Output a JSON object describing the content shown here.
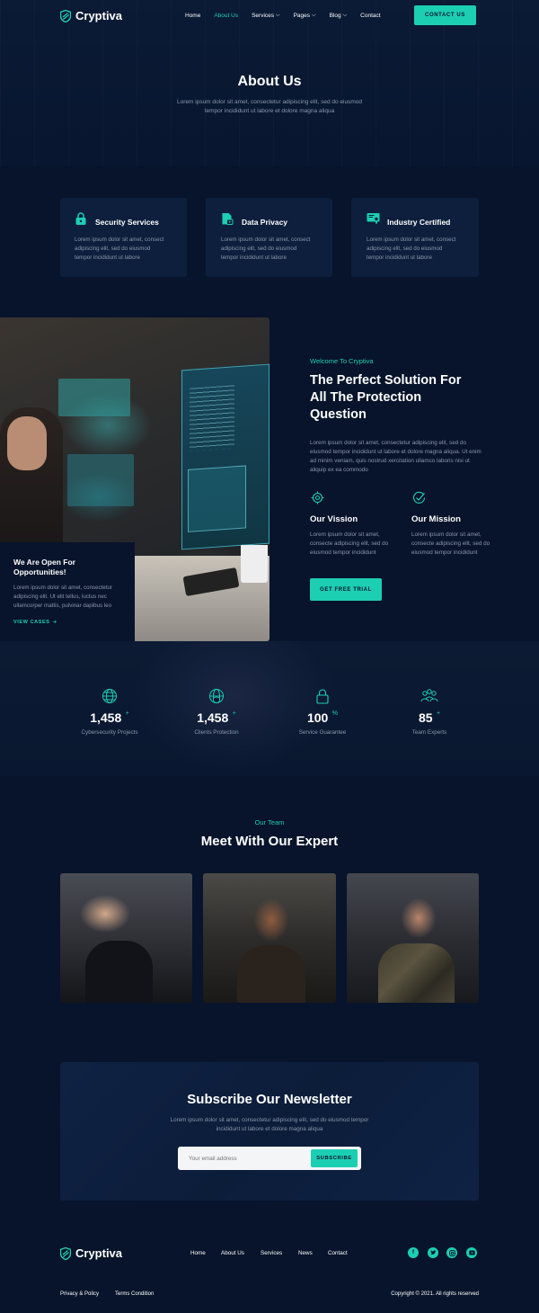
{
  "brand": {
    "name": "Cryptiva",
    "accent": "#1ccfb2",
    "background": "#07142b"
  },
  "nav": {
    "items": [
      "Home",
      "About Us",
      "Services",
      "Pages",
      "Blog",
      "Contact"
    ],
    "active": "About Us",
    "cta": "CONTACT US"
  },
  "hero": {
    "title": "About Us",
    "text1": "Lorem ipsum dolor sit amet, consectetur adipiscing elit, sed do eiusmod",
    "text2": "tempor incididunt ut labore et dolore magna aliqua"
  },
  "features": [
    {
      "icon": "lock-icon",
      "title": "Security Services",
      "l1": "Lorem ipsum dolor sit amet, consect",
      "l2": "adipiscing elit, sed do eiusmod",
      "l3": "tempor incididunt ut labore"
    },
    {
      "icon": "document-lock-icon",
      "title": "Data Privacy",
      "l1": "Lorem ipsum dolor sit amet, consect",
      "l2": "adipiscing elit, sed do eiusmod",
      "l3": "tempor incididunt ut labore"
    },
    {
      "icon": "certificate-icon",
      "title": "Industry Certified",
      "l1": "Lorem ipsum dolor sit amet, consect",
      "l2": "adipiscing elit, sed do eiusmod",
      "l3": "tempor incididunt ut labore"
    }
  ],
  "opportunity": {
    "title1": "We Are Open For",
    "title2": "Opportunities!",
    "l1": "Lorem ipsum dolor sit amet, consectetur",
    "l2": "adipiscing elit. Ut elit tellus, luctus nec",
    "l3": "ullamcorper mattis, pulvinar dapibus leo",
    "link": "VIEW CASES"
  },
  "welcome": {
    "kicker": "Welcome To Cryptiva",
    "h1": "The Perfect Solution For",
    "h2": "All The Protection",
    "h3": "Question",
    "p1": "Lorem ipsum dolor sit amet, consectetur adipiscing elit, sed do",
    "p2": "eiusmod tempor incididunt ut labore et dolore magna aliqua. Ut enim",
    "p3": "ad minim veniam, quis nostrud xercitation ullamco laboris nisi ut",
    "p4": "aliquip ex ea commodo",
    "vision": {
      "title": "Our Vission",
      "l1": "Lorem ipsum dolor sit amet,",
      "l2": "consecte adipiscing elit, sed do",
      "l3": "eiusmod tempor incididunt"
    },
    "mission": {
      "title": "Our Mission",
      "l1": "Lorem ipsum dolor sit amet,",
      "l2": "consecte adipiscing elit, sed do",
      "l3": "eiusmod tempor incididunt"
    },
    "cta": "GET FREE TRIAL"
  },
  "stats": [
    {
      "icon": "globe-icon",
      "value": "1,458",
      "sup": "+",
      "label": "Cybersecurity Projects"
    },
    {
      "icon": "globe-shield-icon",
      "value": "1,458",
      "sup": "+",
      "label": "Clients Protection"
    },
    {
      "icon": "padlock-icon",
      "value": "100",
      "sup": "%",
      "label": "Service Guarantee"
    },
    {
      "icon": "team-icon",
      "value": "85",
      "sup": "+",
      "label": "Team Experts"
    }
  ],
  "team": {
    "kicker": "Our Team",
    "title": "Meet With Our Expert"
  },
  "newsletter": {
    "title": "Subscribe Our Newsletter",
    "l1": "Lorem ipsum dolor sit amet, consectetur adipiscing elit, sed do eiusmod tempor",
    "l2": "incididunt ut labore et dolore magna aliqua",
    "placeholder": "Your email address",
    "button": "SUBSCRIBE"
  },
  "footer": {
    "links": [
      "Home",
      "About Us",
      "Services",
      "News",
      "Contact"
    ],
    "social": [
      "facebook-icon",
      "twitter-icon",
      "instagram-icon",
      "youtube-icon"
    ],
    "privacy": "Privacy & Policy",
    "terms": "Terms Condition",
    "copyright": "Copyright © 2021. All rights reserved"
  }
}
